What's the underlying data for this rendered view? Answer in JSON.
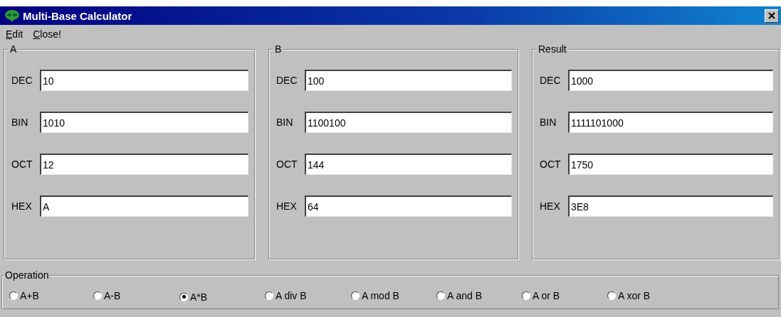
{
  "window": {
    "title": "Multi-Base Calculator"
  },
  "menu": [
    {
      "label": "Edit"
    },
    {
      "label": "Close!"
    }
  ],
  "groups": [
    {
      "title": "A",
      "fields": [
        {
          "label": "DEC",
          "value": "10"
        },
        {
          "label": "BIN",
          "value": "1010"
        },
        {
          "label": "OCT",
          "value": "12"
        },
        {
          "label": "HEX",
          "value": "A"
        }
      ]
    },
    {
      "title": "B",
      "fields": [
        {
          "label": "DEC",
          "value": "100"
        },
        {
          "label": "BIN",
          "value": "1100100"
        },
        {
          "label": "OCT",
          "value": "144"
        },
        {
          "label": "HEX",
          "value": "64"
        }
      ]
    },
    {
      "title": "Result",
      "fields": [
        {
          "label": "DEC",
          "value": "1000"
        },
        {
          "label": "BIN",
          "value": "1111101000"
        },
        {
          "label": "OCT",
          "value": "1750"
        },
        {
          "label": "HEX",
          "value": "3E8"
        }
      ]
    }
  ],
  "operation": {
    "title": "Operation",
    "options": [
      {
        "label": "A+B",
        "selected": false
      },
      {
        "label": "A-B",
        "selected": false
      },
      {
        "label": "A*B",
        "selected": true
      },
      {
        "label": "A div B",
        "selected": false
      },
      {
        "label": "A mod B",
        "selected": false
      },
      {
        "label": "A and B",
        "selected": false
      },
      {
        "label": "A or B",
        "selected": false
      },
      {
        "label": "A xor B",
        "selected": false
      }
    ]
  }
}
